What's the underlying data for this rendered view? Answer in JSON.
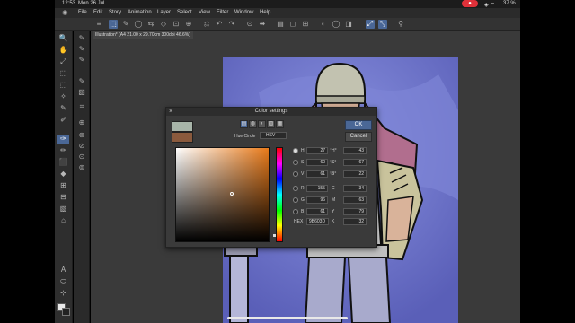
{
  "status_bar": {
    "time": "12:53",
    "date": "Mon 26 Jul",
    "record_indicator": "●",
    "status_icons": "◈ ⌔",
    "battery": "37 %"
  },
  "menu": {
    "items": [
      "File",
      "Edit",
      "Story",
      "Animation",
      "Layer",
      "Select",
      "View",
      "Filter",
      "Window",
      "Help"
    ]
  },
  "document": {
    "tab_label": "Illustration* (A4 21.00 x 29.70cm 300dpi 46.6%)"
  },
  "color_settings": {
    "title": "Color settings",
    "close_glyph": "×",
    "ok_label": "OK",
    "cancel_label": "Cancel",
    "hue_circle_label": "Hue Circle",
    "hue_circle_value": "HSV",
    "mode_buttons": [
      "▤",
      "◍",
      "◐",
      "▨",
      "▦",
      "▥"
    ],
    "values": [
      {
        "label": "H",
        "value": "27",
        "sep": "°",
        "label2": "H°",
        "value2": "43",
        "selected": true
      },
      {
        "label": "S",
        "value": "60",
        "sep": "%",
        "label2": "S°",
        "value2": "67",
        "selected": false
      },
      {
        "label": "V",
        "value": "61",
        "sep": "%",
        "label2": "B°",
        "value2": "22",
        "selected": false
      },
      {
        "label": "R",
        "value": "155",
        "sep": "",
        "label2": "C",
        "value2": "34",
        "selected": false
      },
      {
        "label": "G",
        "value": "96",
        "sep": "",
        "label2": "M",
        "value2": "63",
        "selected": false
      },
      {
        "label": "B",
        "value": "61",
        "sep": "",
        "label2": "Y",
        "value2": "79",
        "selected": false
      }
    ],
    "hex_label": "HEX",
    "hex_value": "9B603D",
    "k_label": "K",
    "k_value": "32",
    "current_color": "#a8b5a9",
    "new_color": "#8a5a3d"
  },
  "colors": {
    "accent": "#4a6796",
    "artwork_background": "#6a6fc4"
  },
  "icons": {
    "logo": "clip-studio-logo-icon",
    "cmd_glyphs": [
      "≡",
      "⬚",
      "✎",
      "◯",
      "⇆",
      "◇",
      "⊡",
      "⊕",
      "⎌",
      "↶",
      "↷",
      "⊙",
      "⬌",
      "▤",
      "◻",
      "⊞",
      "◐",
      "◯",
      "◨",
      "⤢",
      "⤡",
      "⚲"
    ],
    "tool_glyphs": [
      "🔍",
      "✋",
      "⤢",
      "⬚",
      "⬚",
      "✧",
      "✎",
      "✐",
      "✑",
      "✏",
      "⬛",
      "◆",
      "⊞",
      "⊟",
      "▧",
      "⌂",
      "A",
      "⬭",
      "⊹",
      "⬬",
      "⊕"
    ],
    "subtool_glyphs": [
      "✎",
      "✎",
      "✎",
      "✎",
      "▨",
      "⌗",
      "⊕",
      "⊗",
      "⊘",
      "⊙",
      "⊚",
      "⊛",
      "▥",
      "▦"
    ]
  }
}
